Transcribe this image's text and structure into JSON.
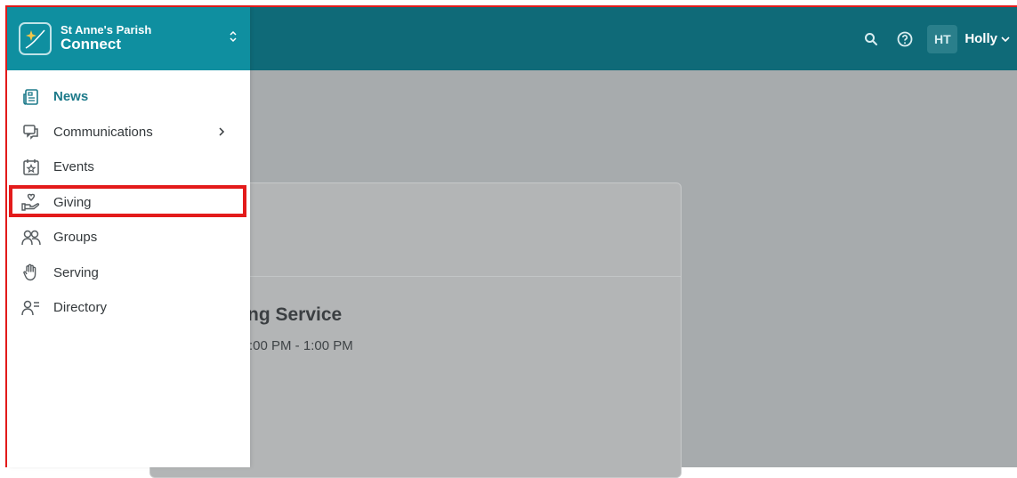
{
  "brand": {
    "parish": "St Anne's Parish",
    "name": "Connect",
    "logo_icon": "sparkle-logo-icon",
    "switch_icon": "chevron-up-down-icon"
  },
  "topbar": {
    "search_icon": "search-icon",
    "help_icon": "help-circle-icon",
    "user_initials": "HT",
    "user_name": "Holly",
    "user_chevron": "chevron-down-icon"
  },
  "sidebar": {
    "items": [
      {
        "label": "News",
        "icon": "newspaper-icon",
        "active": true
      },
      {
        "label": "Communications",
        "icon": "chat-bubbles-icon",
        "has_submenu": true
      },
      {
        "label": "Events",
        "icon": "calendar-star-icon"
      },
      {
        "label": "Giving",
        "icon": "hand-heart-icon",
        "highlighted": true
      },
      {
        "label": "Groups",
        "icon": "people-icon"
      },
      {
        "label": "Serving",
        "icon": "raised-hand-icon"
      },
      {
        "label": "Directory",
        "icon": "person-list-icon"
      }
    ]
  },
  "main": {
    "card_title": "ng Service",
    "card_time": ":00 PM - 1:00 PM"
  },
  "colors": {
    "brand_teal": "#0f8fa0",
    "topbar_teal": "#0f6a78",
    "highlight_red": "#e31b1b",
    "overlay_grey": "#a7abad"
  }
}
